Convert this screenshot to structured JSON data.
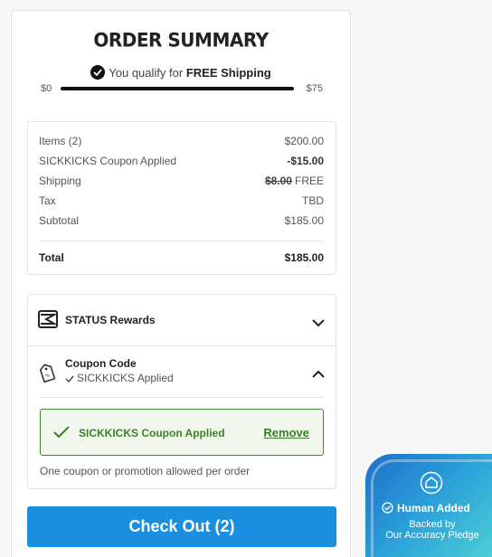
{
  "summary": {
    "title": "ORDER SUMMARY",
    "qualify_prefix": "You qualify for",
    "qualify_highlight": "FREE Shipping",
    "progress": {
      "min_label": "$0",
      "max_label": "$75",
      "fraction": 1.0
    }
  },
  "lines": {
    "items_label": "Items (2)",
    "items_value": "$200.00",
    "coupon_label": "SICKKICKS Coupon Applied",
    "coupon_value": "-$15.00",
    "shipping_label": "Shipping",
    "shipping_strike": "$8.00",
    "shipping_value": "FREE",
    "tax_label": "Tax",
    "tax_value": "TBD",
    "subtotal_label": "Subtotal",
    "subtotal_value": "$185.00",
    "total_label": "Total",
    "total_value": "$185.00"
  },
  "rewards": {
    "label": "STATUS Rewards"
  },
  "coupon": {
    "label": "Coupon Code",
    "status": "SICKKICKS Applied",
    "applied_message": "SICKKICKS Coupon Applied",
    "remove_label": "Remove",
    "note": "One coupon or promotion allowed per order"
  },
  "checkout": {
    "label": "Check Out (2)"
  },
  "badge": {
    "title": "Human Added",
    "line1": "Backed by",
    "line2": "Our Accuracy Pledge"
  },
  "colors": {
    "checkout": "#1a8fe0",
    "applied_green": "#3a7f27",
    "badge_start": "#1e6fc9",
    "badge_end": "#4fd6d6"
  },
  "icons": [
    "check-circle-icon",
    "status-rewards-icon",
    "chevron-down-icon",
    "coupon-tag-icon",
    "checkmark-icon",
    "chevron-up-icon",
    "house-icon",
    "check-circle-outline-icon"
  ]
}
